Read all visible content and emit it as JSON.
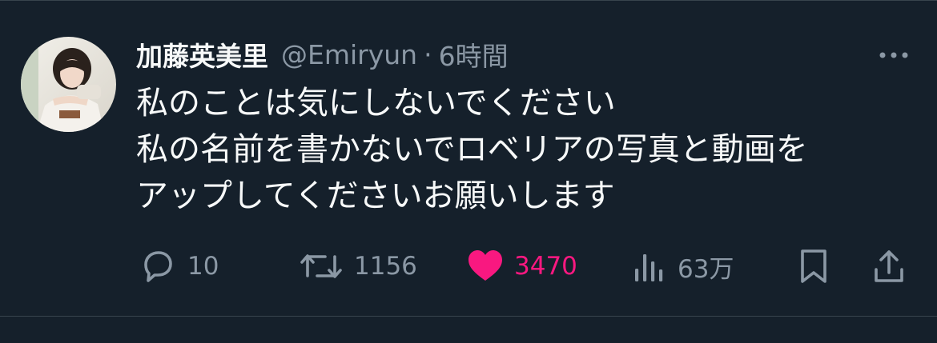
{
  "tweet": {
    "author": {
      "display_name": "加藤英美里",
      "handle": "@Emiryun",
      "separator": "·",
      "time": "6時間"
    },
    "text_lines": [
      "私のことは気にしないでください",
      "私の名前を書かないでロベリアの写真と動画を",
      "アップしてくださいお願いします"
    ],
    "actions": {
      "reply_count": "10",
      "retweet_count": "1156",
      "like_count": "3470",
      "views_count": "63万"
    },
    "liked": true
  },
  "colors": {
    "background": "#15202b",
    "primary_text": "#f7f9f9",
    "secondary_text": "#8b98a5",
    "like_pink": "#f91880",
    "divider": "#38444d"
  },
  "icons": {
    "reply": "reply-icon",
    "retweet": "retweet-icon",
    "like": "heart-icon",
    "views": "views-icon",
    "bookmark": "bookmark-icon",
    "share": "share-icon",
    "more": "more-icon"
  }
}
